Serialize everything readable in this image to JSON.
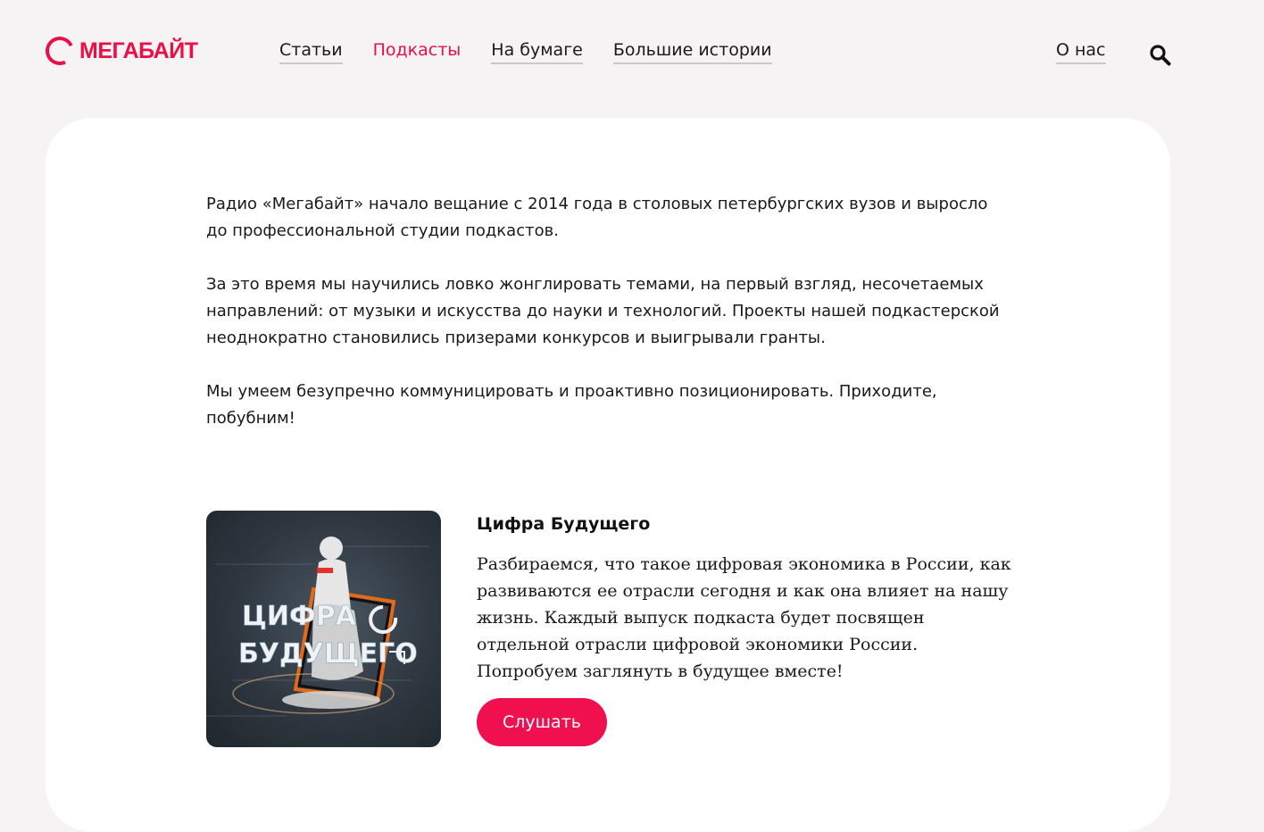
{
  "header": {
    "logo_text": "МЕГАБАЙТ",
    "nav": [
      {
        "label": "Статьи",
        "active": false
      },
      {
        "label": "Подкасты",
        "active": true
      },
      {
        "label": "На бумаге",
        "active": false
      },
      {
        "label": "Большие истории",
        "active": false
      }
    ],
    "about_label": "О нас",
    "search_icon": "search-icon"
  },
  "intro": {
    "paragraphs": [
      "Радио «Мегабайт» начало вещание с 2014 года в столовых петербургских вузов и выросло до профессиональной студии подкастов.",
      "За это время мы научились ловко жонглировать темами, на первый взгляд, несочетаемых направлений: от музыки и искусства до науки и технологий. Проекты нашей подкастерской неоднократно становились призерами конкурсов и выигрывали гранты.",
      "Мы умеем безупречно коммуницировать и проактивно позиционировать. Приходите, побубним!"
    ]
  },
  "podcast": {
    "title": "Цифра Будущего",
    "cover_text_line1": "ЦИФРА",
    "cover_text_line2": "БУДУЩЕГО",
    "description": "Разбираемся, что такое цифровая экономика в России, как развиваются ее отрасли сегодня и как она влияет на нашу жизнь.    Каждый выпуск подкаста будет посвящен отдельной отрасли цифровой экономики России.    Попробуем заглянуть в будущее вместе!",
    "listen_label": "Слушать"
  },
  "colors": {
    "brand": "#ec0f47",
    "button": "#f00f4f",
    "background": "#f5f3f4",
    "card": "#ffffff"
  }
}
